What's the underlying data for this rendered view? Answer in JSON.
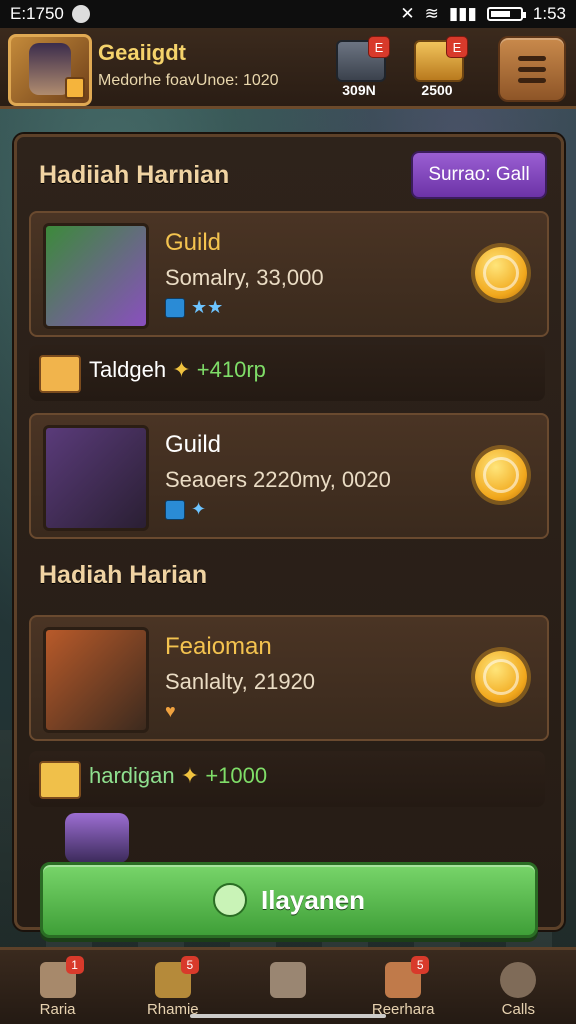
{
  "status": {
    "time_left": "E:1750",
    "time_right": "1:53"
  },
  "header": {
    "player_name": "Geaiigdt",
    "player_subtitle": "Medorhe foavUnoe: 1020",
    "resources": [
      {
        "name": "chest-resource",
        "badge": "E",
        "value": "309N",
        "color": "#4c5563"
      },
      {
        "name": "gold-resource",
        "badge": "E",
        "value": "2500",
        "color": "#d39a2f"
      }
    ]
  },
  "panel": {
    "section1_title": "Hadiiah Harnian",
    "season_button": "Surrao: Gall",
    "cards": [
      {
        "title": "Guild",
        "subtitle": "Somalry, 33,000",
        "title_color": "gold"
      },
      {
        "title": "Guild",
        "subtitle": "Seaoers 2220my, 0020",
        "title_color": "white"
      },
      {
        "title": "Feaioman",
        "subtitle": "Sanlalty, 21920",
        "title_color": "gold"
      }
    ],
    "strip1": {
      "label": "Taldgeh",
      "points": "+410rp"
    },
    "section2_title": "Hadiah Harian",
    "strip2": {
      "label": "hardigan",
      "points": "+1000"
    },
    "cta_label": "Ilayanen"
  },
  "bottom_nav": [
    {
      "label": "Raria",
      "badge": "1"
    },
    {
      "label": "Rhamie",
      "badge": "5"
    },
    {
      "label": "",
      "badge": ""
    },
    {
      "label": "Reerhara",
      "badge": "5"
    },
    {
      "label": "Calls",
      "badge": ""
    }
  ],
  "colors": {
    "accent_green": "#4fb243",
    "accent_purple": "#7a3fb6",
    "gold": "#f4c34f"
  }
}
